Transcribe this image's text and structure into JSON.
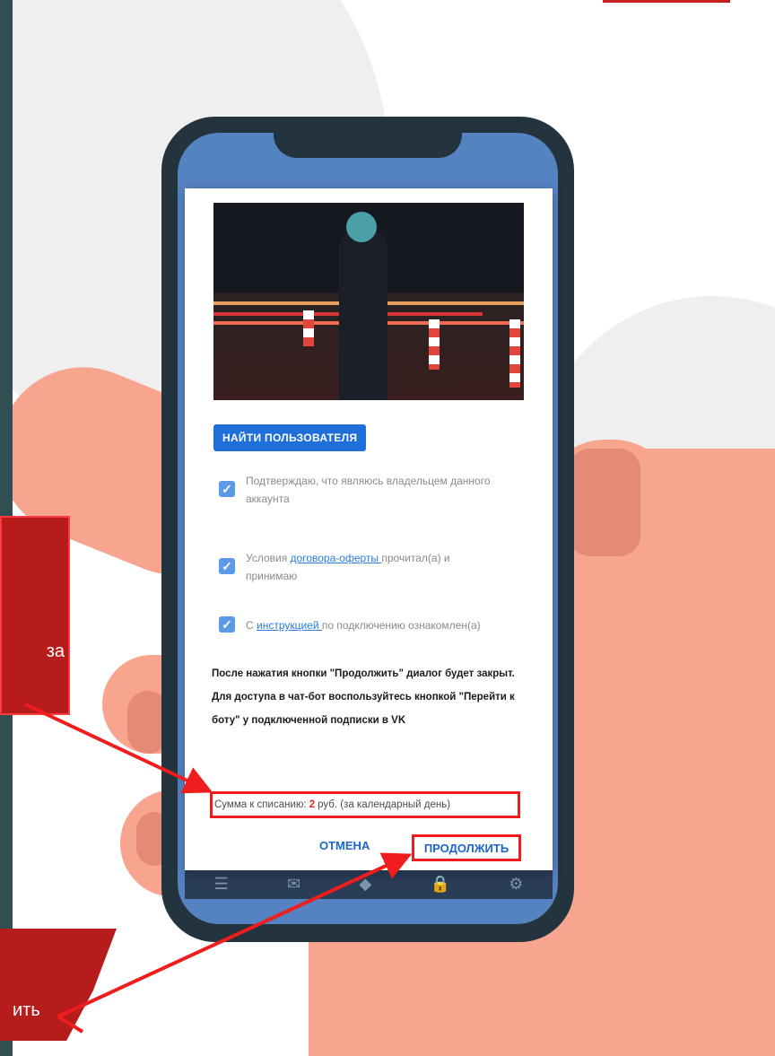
{
  "dialog": {
    "find_button": "НАЙТИ ПОЛЬЗОВАТЕЛЯ",
    "checks": [
      {
        "pre": "Подтверждаю, что являюсь владельцем данного аккаунта",
        "link": "",
        "post": "",
        "checked": true
      },
      {
        "pre": "Условия ",
        "link": "договора-оферты ",
        "post": "прочитал(а) и принимаю",
        "checked": true
      },
      {
        "pre": "С ",
        "link": "инструкцией ",
        "post": "по подключению ознакомлен(а)",
        "checked": true
      }
    ],
    "notice": "После нажатия кнопки \"Продолжить\" диалог будет закрыт. Для доступа в чат-бот воспользуйтесь кнопкой \"Перейти к боту\" у подключенной подписки в VK",
    "sum_prefix": "Сумма к списанию:",
    "sum_amount": "2",
    "sum_suffix": "руб. (за календарный день)",
    "cancel_label": "ОТМЕНА",
    "continue_label": "ПРОДОЛЖИТЬ"
  },
  "callouts": {
    "first_text": "за",
    "second_text": "ить"
  },
  "bottom_nav": [
    {
      "icon": "list-icon"
    },
    {
      "icon": "mail-icon"
    },
    {
      "icon": "tag-icon"
    },
    {
      "icon": "lock-icon"
    },
    {
      "icon": "gear-icon"
    }
  ],
  "colors": {
    "accent_red": "#ef1d1d",
    "primary_blue": "#1e6fd9",
    "callout_red": "#b71c1c"
  }
}
